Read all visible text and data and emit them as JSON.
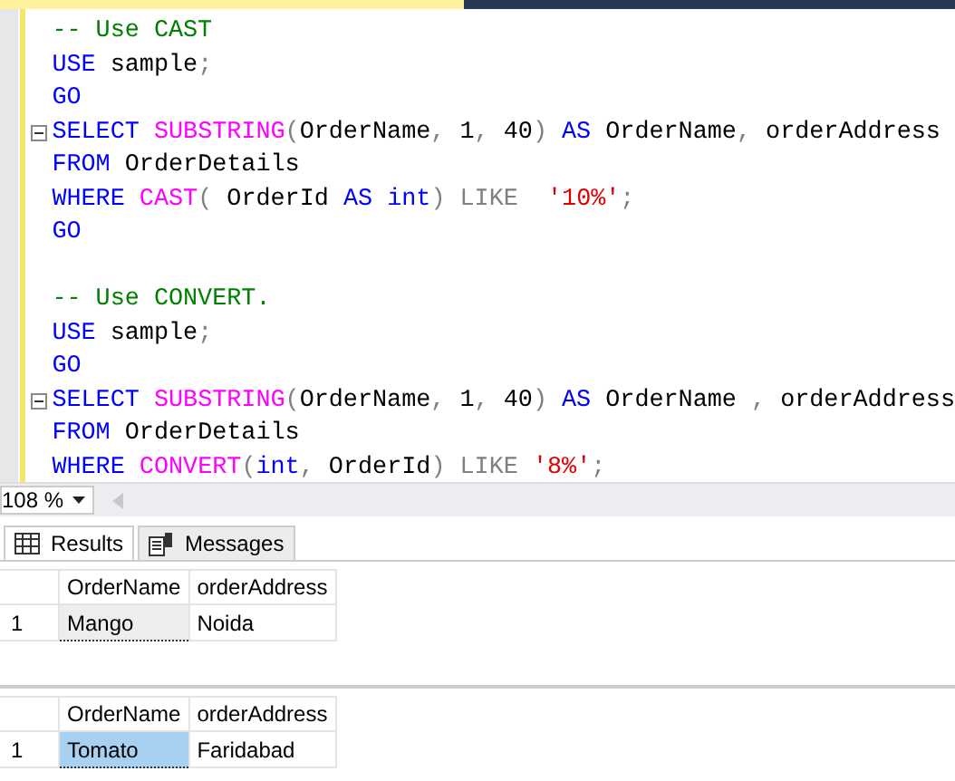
{
  "editor": {
    "blocks": [
      {
        "lines": [
          {
            "tokens": [
              {
                "kind": "comment",
                "text": "-- Use CAST"
              }
            ]
          },
          {
            "tokens": [
              {
                "kind": "keyword",
                "text": "USE"
              },
              {
                "kind": "plain",
                "text": " sample"
              },
              {
                "kind": "operator",
                "text": ";"
              }
            ]
          },
          {
            "tokens": [
              {
                "kind": "keyword",
                "text": "GO"
              }
            ]
          },
          {
            "collapsible": true,
            "tokens": [
              {
                "kind": "keyword",
                "text": "SELECT"
              },
              {
                "kind": "function",
                "text": " SUBSTRING"
              },
              {
                "kind": "operator",
                "text": "("
              },
              {
                "kind": "plain",
                "text": "OrderName"
              },
              {
                "kind": "operator",
                "text": ","
              },
              {
                "kind": "plain",
                "text": " 1"
              },
              {
                "kind": "operator",
                "text": ","
              },
              {
                "kind": "plain",
                "text": " 40"
              },
              {
                "kind": "operator",
                "text": ")"
              },
              {
                "kind": "keyword",
                "text": " AS"
              },
              {
                "kind": "plain",
                "text": " OrderName"
              },
              {
                "kind": "operator",
                "text": ","
              },
              {
                "kind": "plain",
                "text": " orderAddress"
              }
            ]
          },
          {
            "tokens": [
              {
                "kind": "keyword",
                "text": "FROM"
              },
              {
                "kind": "plain",
                "text": " OrderDetails"
              }
            ]
          },
          {
            "tokens": [
              {
                "kind": "keyword",
                "text": "WHERE"
              },
              {
                "kind": "function",
                "text": " CAST"
              },
              {
                "kind": "operator",
                "text": "("
              },
              {
                "kind": "plain",
                "text": " OrderId"
              },
              {
                "kind": "keyword",
                "text": " AS"
              },
              {
                "kind": "keyword",
                "text": " int"
              },
              {
                "kind": "operator",
                "text": ")"
              },
              {
                "kind": "operator",
                "text": " LIKE"
              },
              {
                "kind": "string",
                "text": "  '10%'"
              },
              {
                "kind": "operator",
                "text": ";"
              }
            ]
          },
          {
            "tokens": [
              {
                "kind": "keyword",
                "text": "GO"
              }
            ]
          }
        ]
      },
      {
        "lines": [
          {
            "tokens": [
              {
                "kind": "comment",
                "text": "-- Use CONVERT."
              }
            ]
          },
          {
            "tokens": [
              {
                "kind": "keyword",
                "text": "USE"
              },
              {
                "kind": "plain",
                "text": " sample"
              },
              {
                "kind": "operator",
                "text": ";"
              }
            ]
          },
          {
            "tokens": [
              {
                "kind": "keyword",
                "text": "GO"
              }
            ]
          },
          {
            "collapsible": true,
            "tokens": [
              {
                "kind": "keyword",
                "text": "SELECT"
              },
              {
                "kind": "function",
                "text": " SUBSTRING"
              },
              {
                "kind": "operator",
                "text": "("
              },
              {
                "kind": "plain",
                "text": "OrderName"
              },
              {
                "kind": "operator",
                "text": ","
              },
              {
                "kind": "plain",
                "text": " 1"
              },
              {
                "kind": "operator",
                "text": ","
              },
              {
                "kind": "plain",
                "text": " 40"
              },
              {
                "kind": "operator",
                "text": ")"
              },
              {
                "kind": "keyword",
                "text": " AS"
              },
              {
                "kind": "plain",
                "text": " OrderName"
              },
              {
                "kind": "operator",
                "text": " ,"
              },
              {
                "kind": "plain",
                "text": " orderAddress"
              }
            ]
          },
          {
            "tokens": [
              {
                "kind": "keyword",
                "text": "FROM"
              },
              {
                "kind": "plain",
                "text": " OrderDetails"
              }
            ]
          },
          {
            "tokens": [
              {
                "kind": "keyword",
                "text": "WHERE"
              },
              {
                "kind": "function",
                "text": " CONVERT"
              },
              {
                "kind": "operator",
                "text": "("
              },
              {
                "kind": "keyword",
                "text": "int"
              },
              {
                "kind": "operator",
                "text": ","
              },
              {
                "kind": "plain",
                "text": " OrderId"
              },
              {
                "kind": "operator",
                "text": ")"
              },
              {
                "kind": "operator",
                "text": " LIKE"
              },
              {
                "kind": "string",
                "text": " '8%'"
              },
              {
                "kind": "operator",
                "text": ";"
              }
            ]
          }
        ]
      }
    ]
  },
  "zoom": {
    "value": "108 %"
  },
  "tabs": [
    {
      "label": "Results",
      "kind": "grid",
      "selected": true
    },
    {
      "label": "Messages",
      "kind": "text",
      "selected": false
    }
  ],
  "results": [
    {
      "columns": [
        "OrderName",
        "orderAddress"
      ],
      "rows": [
        {
          "number": "1",
          "cells": [
            {
              "text": "Mango",
              "selected": false,
              "focused": true
            },
            {
              "text": "Noida",
              "selected": false,
              "focused": false
            }
          ]
        }
      ]
    },
    {
      "columns": [
        "OrderName",
        "orderAddress"
      ],
      "rows": [
        {
          "number": "1",
          "cells": [
            {
              "text": "Tomato",
              "selected": true,
              "focused": true
            },
            {
              "text": "Faridabad",
              "selected": false,
              "focused": false
            }
          ]
        }
      ]
    }
  ]
}
